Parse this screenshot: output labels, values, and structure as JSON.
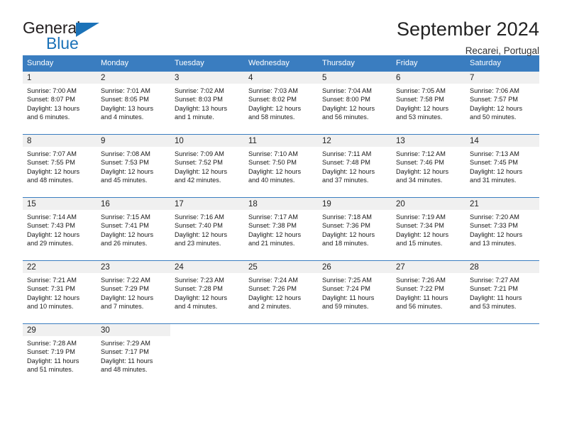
{
  "brand": {
    "name_top": "General",
    "name_bottom": "Blue",
    "triangle_color": "#1b72b8"
  },
  "header": {
    "title": "September 2024",
    "location": "Recarei, Portugal"
  },
  "theme": {
    "header_bar_color": "#3a7dc0",
    "daynum_band_color": "#f0f0f0",
    "row_border_color": "#3a7dc0",
    "text_color": "#1a1a1a"
  },
  "columns": [
    "Sunday",
    "Monday",
    "Tuesday",
    "Wednesday",
    "Thursday",
    "Friday",
    "Saturday"
  ],
  "labels": {
    "sunrise_prefix": "Sunrise:",
    "sunset_prefix": "Sunset:",
    "daylight_prefix": "Daylight:"
  },
  "weeks": [
    [
      {
        "day": "1",
        "sunrise": "Sunrise: 7:00 AM",
        "sunset": "Sunset: 8:07 PM",
        "daylight_line1": "Daylight: 13 hours",
        "daylight_line2": "and 6 minutes."
      },
      {
        "day": "2",
        "sunrise": "Sunrise: 7:01 AM",
        "sunset": "Sunset: 8:05 PM",
        "daylight_line1": "Daylight: 13 hours",
        "daylight_line2": "and 4 minutes."
      },
      {
        "day": "3",
        "sunrise": "Sunrise: 7:02 AM",
        "sunset": "Sunset: 8:03 PM",
        "daylight_line1": "Daylight: 13 hours",
        "daylight_line2": "and 1 minute."
      },
      {
        "day": "4",
        "sunrise": "Sunrise: 7:03 AM",
        "sunset": "Sunset: 8:02 PM",
        "daylight_line1": "Daylight: 12 hours",
        "daylight_line2": "and 58 minutes."
      },
      {
        "day": "5",
        "sunrise": "Sunrise: 7:04 AM",
        "sunset": "Sunset: 8:00 PM",
        "daylight_line1": "Daylight: 12 hours",
        "daylight_line2": "and 56 minutes."
      },
      {
        "day": "6",
        "sunrise": "Sunrise: 7:05 AM",
        "sunset": "Sunset: 7:58 PM",
        "daylight_line1": "Daylight: 12 hours",
        "daylight_line2": "and 53 minutes."
      },
      {
        "day": "7",
        "sunrise": "Sunrise: 7:06 AM",
        "sunset": "Sunset: 7:57 PM",
        "daylight_line1": "Daylight: 12 hours",
        "daylight_line2": "and 50 minutes."
      }
    ],
    [
      {
        "day": "8",
        "sunrise": "Sunrise: 7:07 AM",
        "sunset": "Sunset: 7:55 PM",
        "daylight_line1": "Daylight: 12 hours",
        "daylight_line2": "and 48 minutes."
      },
      {
        "day": "9",
        "sunrise": "Sunrise: 7:08 AM",
        "sunset": "Sunset: 7:53 PM",
        "daylight_line1": "Daylight: 12 hours",
        "daylight_line2": "and 45 minutes."
      },
      {
        "day": "10",
        "sunrise": "Sunrise: 7:09 AM",
        "sunset": "Sunset: 7:52 PM",
        "daylight_line1": "Daylight: 12 hours",
        "daylight_line2": "and 42 minutes."
      },
      {
        "day": "11",
        "sunrise": "Sunrise: 7:10 AM",
        "sunset": "Sunset: 7:50 PM",
        "daylight_line1": "Daylight: 12 hours",
        "daylight_line2": "and 40 minutes."
      },
      {
        "day": "12",
        "sunrise": "Sunrise: 7:11 AM",
        "sunset": "Sunset: 7:48 PM",
        "daylight_line1": "Daylight: 12 hours",
        "daylight_line2": "and 37 minutes."
      },
      {
        "day": "13",
        "sunrise": "Sunrise: 7:12 AM",
        "sunset": "Sunset: 7:46 PM",
        "daylight_line1": "Daylight: 12 hours",
        "daylight_line2": "and 34 minutes."
      },
      {
        "day": "14",
        "sunrise": "Sunrise: 7:13 AM",
        "sunset": "Sunset: 7:45 PM",
        "daylight_line1": "Daylight: 12 hours",
        "daylight_line2": "and 31 minutes."
      }
    ],
    [
      {
        "day": "15",
        "sunrise": "Sunrise: 7:14 AM",
        "sunset": "Sunset: 7:43 PM",
        "daylight_line1": "Daylight: 12 hours",
        "daylight_line2": "and 29 minutes."
      },
      {
        "day": "16",
        "sunrise": "Sunrise: 7:15 AM",
        "sunset": "Sunset: 7:41 PM",
        "daylight_line1": "Daylight: 12 hours",
        "daylight_line2": "and 26 minutes."
      },
      {
        "day": "17",
        "sunrise": "Sunrise: 7:16 AM",
        "sunset": "Sunset: 7:40 PM",
        "daylight_line1": "Daylight: 12 hours",
        "daylight_line2": "and 23 minutes."
      },
      {
        "day": "18",
        "sunrise": "Sunrise: 7:17 AM",
        "sunset": "Sunset: 7:38 PM",
        "daylight_line1": "Daylight: 12 hours",
        "daylight_line2": "and 21 minutes."
      },
      {
        "day": "19",
        "sunrise": "Sunrise: 7:18 AM",
        "sunset": "Sunset: 7:36 PM",
        "daylight_line1": "Daylight: 12 hours",
        "daylight_line2": "and 18 minutes."
      },
      {
        "day": "20",
        "sunrise": "Sunrise: 7:19 AM",
        "sunset": "Sunset: 7:34 PM",
        "daylight_line1": "Daylight: 12 hours",
        "daylight_line2": "and 15 minutes."
      },
      {
        "day": "21",
        "sunrise": "Sunrise: 7:20 AM",
        "sunset": "Sunset: 7:33 PM",
        "daylight_line1": "Daylight: 12 hours",
        "daylight_line2": "and 13 minutes."
      }
    ],
    [
      {
        "day": "22",
        "sunrise": "Sunrise: 7:21 AM",
        "sunset": "Sunset: 7:31 PM",
        "daylight_line1": "Daylight: 12 hours",
        "daylight_line2": "and 10 minutes."
      },
      {
        "day": "23",
        "sunrise": "Sunrise: 7:22 AM",
        "sunset": "Sunset: 7:29 PM",
        "daylight_line1": "Daylight: 12 hours",
        "daylight_line2": "and 7 minutes."
      },
      {
        "day": "24",
        "sunrise": "Sunrise: 7:23 AM",
        "sunset": "Sunset: 7:28 PM",
        "daylight_line1": "Daylight: 12 hours",
        "daylight_line2": "and 4 minutes."
      },
      {
        "day": "25",
        "sunrise": "Sunrise: 7:24 AM",
        "sunset": "Sunset: 7:26 PM",
        "daylight_line1": "Daylight: 12 hours",
        "daylight_line2": "and 2 minutes."
      },
      {
        "day": "26",
        "sunrise": "Sunrise: 7:25 AM",
        "sunset": "Sunset: 7:24 PM",
        "daylight_line1": "Daylight: 11 hours",
        "daylight_line2": "and 59 minutes."
      },
      {
        "day": "27",
        "sunrise": "Sunrise: 7:26 AM",
        "sunset": "Sunset: 7:22 PM",
        "daylight_line1": "Daylight: 11 hours",
        "daylight_line2": "and 56 minutes."
      },
      {
        "day": "28",
        "sunrise": "Sunrise: 7:27 AM",
        "sunset": "Sunset: 7:21 PM",
        "daylight_line1": "Daylight: 11 hours",
        "daylight_line2": "and 53 minutes."
      }
    ],
    [
      {
        "day": "29",
        "sunrise": "Sunrise: 7:28 AM",
        "sunset": "Sunset: 7:19 PM",
        "daylight_line1": "Daylight: 11 hours",
        "daylight_line2": "and 51 minutes."
      },
      {
        "day": "30",
        "sunrise": "Sunrise: 7:29 AM",
        "sunset": "Sunset: 7:17 PM",
        "daylight_line1": "Daylight: 11 hours",
        "daylight_line2": "and 48 minutes."
      },
      {
        "day": "",
        "sunrise": "",
        "sunset": "",
        "daylight_line1": "",
        "daylight_line2": ""
      },
      {
        "day": "",
        "sunrise": "",
        "sunset": "",
        "daylight_line1": "",
        "daylight_line2": ""
      },
      {
        "day": "",
        "sunrise": "",
        "sunset": "",
        "daylight_line1": "",
        "daylight_line2": ""
      },
      {
        "day": "",
        "sunrise": "",
        "sunset": "",
        "daylight_line1": "",
        "daylight_line2": ""
      },
      {
        "day": "",
        "sunrise": "",
        "sunset": "",
        "daylight_line1": "",
        "daylight_line2": ""
      }
    ]
  ]
}
